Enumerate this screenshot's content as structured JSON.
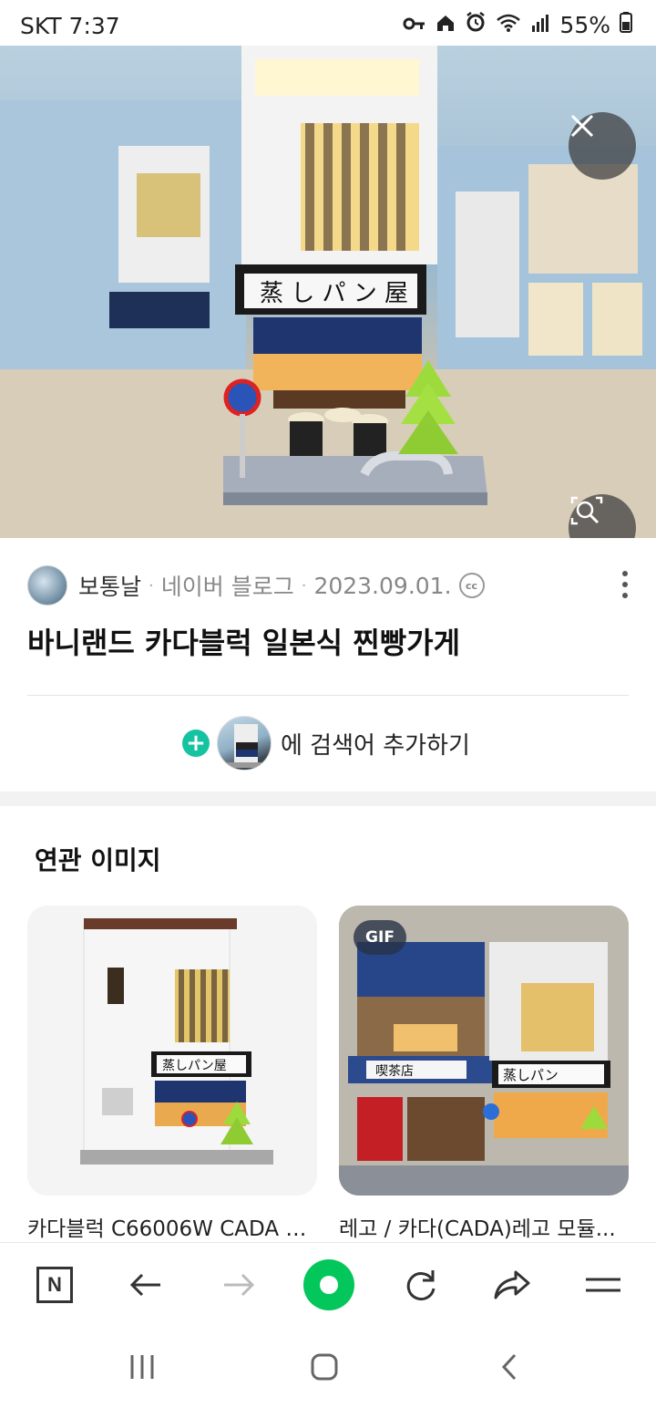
{
  "status_bar": {
    "carrier_time": "SKT 7:37",
    "battery": "55%",
    "icons": [
      "key-icon",
      "home-icon",
      "alarm-icon",
      "wifi-icon",
      "signal-icon",
      "battery-icon"
    ]
  },
  "hero": {
    "close_icon": "close-icon",
    "lens_icon": "image-search-icon"
  },
  "source": {
    "author": "보통날",
    "platform": "네이버 블로그",
    "date": "2023.09.01.",
    "license_badge": "cc",
    "more_icon": "more-vertical-icon"
  },
  "title": "바니랜드 카다블럭 일본식 찐빵가게",
  "add_search": {
    "plus": "+",
    "text": "에 검색어 추가하기"
  },
  "related": {
    "heading": "연관 이미지",
    "items": [
      {
        "caption": "카다블럭 C66006W CADA 테...",
        "badge": ""
      },
      {
        "caption": "레고 / 카다(CADA)레고 모듈...",
        "badge": "GIF"
      }
    ]
  },
  "toolbar": {
    "home_label": "N",
    "items": [
      "naver-home-icon",
      "back-arrow-icon",
      "forward-arrow-icon",
      "green-dot-icon",
      "refresh-icon",
      "share-icon",
      "menu-icon"
    ]
  },
  "navbar": {
    "items": [
      "recents-icon",
      "home-icon",
      "back-icon"
    ]
  },
  "colors": {
    "accent_green": "#03c75a",
    "plus_teal": "#16c3a0"
  }
}
